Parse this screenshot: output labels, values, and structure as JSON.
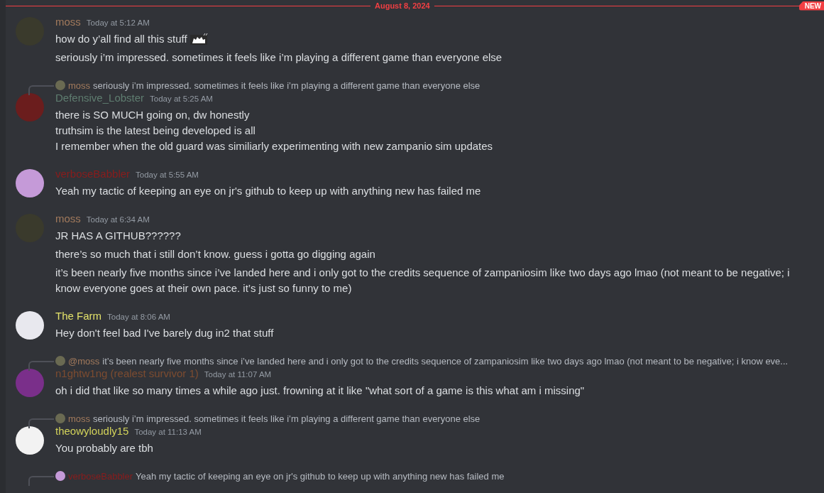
{
  "divider": {
    "label": "August 8, 2024",
    "badge": "NEW"
  },
  "groups": [
    {
      "author": "moss",
      "color": "#a27a5c",
      "time": "Today at 5:12 AM",
      "messages": [
        {
          "lines": [
            "how do y’all find all this stuff"
          ],
          "emoji": true
        },
        {
          "lines": [
            "seriously i’m impressed. sometimes it feels like i’m playing a different game than everyone else"
          ],
          "emoji": false
        }
      ]
    },
    {
      "reply": {
        "author": "moss",
        "color": "#a27a5c",
        "text": "seriously i’m impressed. sometimes it feels like i’m playing a different game than everyone else"
      },
      "author": "Defensive_Lobster",
      "color": "#5f7d70",
      "time": "Today at 5:25 AM",
      "messages": [
        {
          "lines": [
            "there is SO MUCH going on, dw honestly",
            "truthsim is the latest being developed is all",
            "I remember when the old guard was similiarly experimenting with new zampanio sim updates"
          ],
          "emoji": false
        }
      ]
    },
    {
      "author": "verboseBabbler",
      "color": "#8a1c1c",
      "time": "Today at 5:55 AM",
      "messages": [
        {
          "lines": [
            "Yeah my tactic of keeping an eye on jr's github to keep up with anything new has failed me"
          ],
          "emoji": false
        }
      ]
    },
    {
      "author": "moss",
      "color": "#a27a5c",
      "time": "Today at 6:34 AM",
      "messages": [
        {
          "lines": [
            "JR HAS A GITHUB??????"
          ],
          "emoji": false
        },
        {
          "lines": [
            "there’s so much that i still don’t know. guess i gotta go digging again"
          ],
          "emoji": false
        },
        {
          "lines": [
            "it’s been nearly five months since i’ve landed here and i only got to the credits sequence of zampaniosim like two days ago lmao (not meant to be negative; i know everyone goes at their own pace. it’s just so funny to me)"
          ],
          "emoji": false
        }
      ]
    },
    {
      "author": "The Farm",
      "color": "#e3e26a",
      "time": "Today at 8:06 AM",
      "messages": [
        {
          "lines": [
            "Hey don't feel bad I've barely dug in2 that stuff"
          ],
          "emoji": false
        }
      ]
    },
    {
      "reply": {
        "author": "@moss",
        "color": "#a27a5c",
        "text": "it’s been nearly five months since i’ve landed here and i only got to the credits sequence of zampaniosim like two days ago lmao (not meant to be negative; i know eve..."
      },
      "author": "n1ghtw1ng (realest survivor 1)",
      "color": "#7d4c30",
      "time": "Today at 11:07 AM",
      "messages": [
        {
          "lines": [
            "oh i did that like so many times a while ago just. frowning at it like \"what sort of a game is this what am i missing\""
          ],
          "emoji": false
        }
      ]
    },
    {
      "reply": {
        "author": "moss",
        "color": "#a27a5c",
        "text": "seriously i’m impressed. sometimes it feels like i’m playing a different game than everyone else"
      },
      "author": "theowyloudly15",
      "color": "#d2d25a",
      "time": "Today at 11:13 AM",
      "messages": [
        {
          "lines": [
            "You probably are tbh"
          ],
          "emoji": false
        }
      ]
    },
    {
      "reply": {
        "author": "verboseBabbler",
        "color": "#8a1c1c",
        "text": "Yeah my tactic of keeping an eye on jr's github to keep up with anything new has failed me"
      }
    }
  ]
}
